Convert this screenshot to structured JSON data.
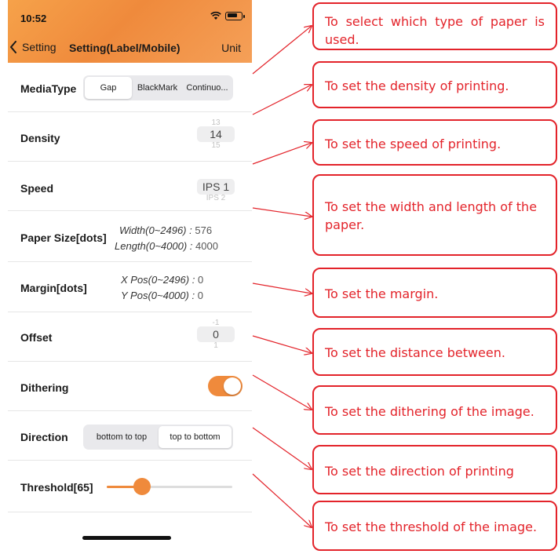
{
  "status_bar": {
    "time": "10:52"
  },
  "nav": {
    "back_label": "Setting",
    "title": "Setting(Label/Mobile)",
    "unit_label": "Unit"
  },
  "settings": {
    "media_type": {
      "label": "MediaType",
      "options": [
        "Gap",
        "BlackMark",
        "Continuo..."
      ],
      "selected": "Gap"
    },
    "density": {
      "label": "Density",
      "prev": "13",
      "value": "14",
      "next": "15"
    },
    "speed": {
      "label": "Speed",
      "value": "IPS 1",
      "next": "IPS 2"
    },
    "paper_size": {
      "label": "Paper Size[dots]",
      "width_label": "Width(0~2496) :",
      "width_value": "576",
      "length_label": "Length(0~4000) :",
      "length_value": "4000"
    },
    "margin": {
      "label": "Margin[dots]",
      "x_label": "X Pos(0~2496) :",
      "x_value": "0",
      "y_label": "Y Pos(0~4000) :",
      "y_value": "0"
    },
    "offset": {
      "label": "Offset",
      "prev": "-1",
      "value": "0",
      "next": "1"
    },
    "dithering": {
      "label": "Dithering",
      "on": true
    },
    "direction": {
      "label": "Direction",
      "options": [
        "bottom to top",
        "top to bottom"
      ],
      "selected": "top to bottom"
    },
    "threshold": {
      "label": "Threshold[65]",
      "value": 65
    }
  },
  "annotations": [
    "To select which type of paper is used.",
    "To set the density of printing.",
    "To set the speed of printing.",
    "To set the width and length of the paper.",
    "To set the margin.",
    "To set the distance between.",
    "To set the dithering of the image.",
    "To set the direction of printing",
    "To set the threshold of the image."
  ],
  "colors": {
    "accent": "#ef8a3c",
    "annotation": "#e3232a"
  }
}
